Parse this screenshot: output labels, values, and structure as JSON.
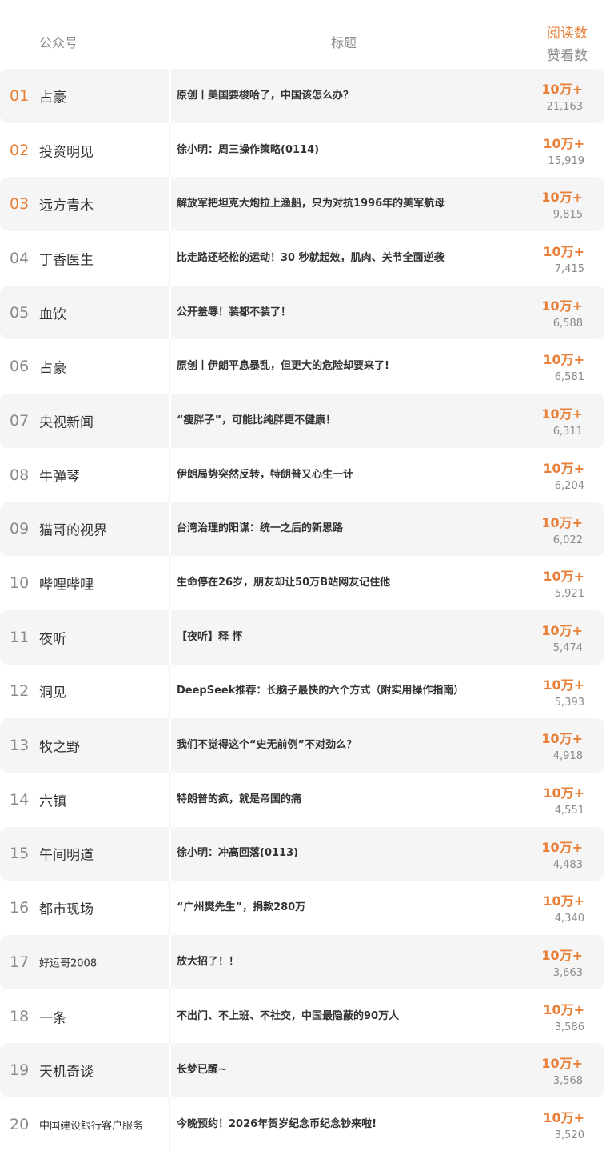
{
  "header": {
    "account_label": "公众号",
    "title_label": "标题",
    "reads_label": "阅读数",
    "likes_label": "赞看数"
  },
  "colors": {
    "accent": "#e8803a",
    "row_bg": "#f5f5f5",
    "text": "#333333",
    "muted": "#8a8a8a"
  },
  "rows": [
    {
      "rank": "01",
      "account": "占豪",
      "title": "原创丨美国要梭哈了，中国该怎么办？",
      "reads": "10万+",
      "likes": "21,163"
    },
    {
      "rank": "02",
      "account": "投资明见",
      "title": "徐小明：周三操作策略(0114)",
      "reads": "10万+",
      "likes": "15,919"
    },
    {
      "rank": "03",
      "account": "远方青木",
      "title": "解放军把坦克大炮拉上渔船，只为对抗1996年的美军航母",
      "reads": "10万+",
      "likes": "9,815"
    },
    {
      "rank": "04",
      "account": "丁香医生",
      "title": "比走路还轻松的运动！30 秒就起效，肌肉、关节全面逆袭",
      "reads": "10万+",
      "likes": "7,415"
    },
    {
      "rank": "05",
      "account": "血饮",
      "title": "公开羞辱！装都不装了！",
      "reads": "10万+",
      "likes": "6,588"
    },
    {
      "rank": "06",
      "account": "占豪",
      "title": "原创丨伊朗平息暴乱，但更大的危险却要来了!",
      "reads": "10万+",
      "likes": "6,581"
    },
    {
      "rank": "07",
      "account": "央视新闻",
      "title": "“瘦胖子”，可能比纯胖更不健康！",
      "reads": "10万+",
      "likes": "6,311"
    },
    {
      "rank": "08",
      "account": "牛弹琴",
      "title": "伊朗局势突然反转，特朗普又心生一计",
      "reads": "10万+",
      "likes": "6,204"
    },
    {
      "rank": "09",
      "account": "猫哥的视界",
      "title": "台湾治理的阳谋：统一之后的新思路",
      "reads": "10万+",
      "likes": "6,022"
    },
    {
      "rank": "10",
      "account": "哔哩哔哩",
      "title": "生命停在26岁，朋友却让50万B站网友记住他",
      "reads": "10万+",
      "likes": "5,921"
    },
    {
      "rank": "11",
      "account": "夜听",
      "title": "【夜听】释 怀",
      "reads": "10万+",
      "likes": "5,474"
    },
    {
      "rank": "12",
      "account": "洞见",
      "title": "DeepSeek推荐：长脑子最快的六个方式（附实用操作指南）",
      "reads": "10万+",
      "likes": "5,393"
    },
    {
      "rank": "13",
      "account": "牧之野",
      "title": "我们不觉得这个“史无前例”不对劲么？",
      "reads": "10万+",
      "likes": "4,918"
    },
    {
      "rank": "14",
      "account": "六镇",
      "title": "特朗普的疯，就是帝国的痛",
      "reads": "10万+",
      "likes": "4,551"
    },
    {
      "rank": "15",
      "account": "午间明道",
      "title": "徐小明：冲高回落(0113)",
      "reads": "10万+",
      "likes": "4,483"
    },
    {
      "rank": "16",
      "account": "都市现场",
      "title": "“广州樊先生”，捐款280万",
      "reads": "10万+",
      "likes": "4,340"
    },
    {
      "rank": "17",
      "account": "好运哥2008",
      "title": "放大招了！！",
      "reads": "10万+",
      "likes": "3,663"
    },
    {
      "rank": "18",
      "account": "一条",
      "title": "不出门、不上班、不社交，中国最隐蔽的90万人",
      "reads": "10万+",
      "likes": "3,586"
    },
    {
      "rank": "19",
      "account": "天机奇谈",
      "title": "长梦已醒~",
      "reads": "10万+",
      "likes": "3,568"
    },
    {
      "rank": "20",
      "account": "中国建设银行客户服务",
      "title": "今晚预约！2026年贺岁纪念币纪念钞来啦!",
      "reads": "10万+",
      "likes": "3,520"
    }
  ]
}
